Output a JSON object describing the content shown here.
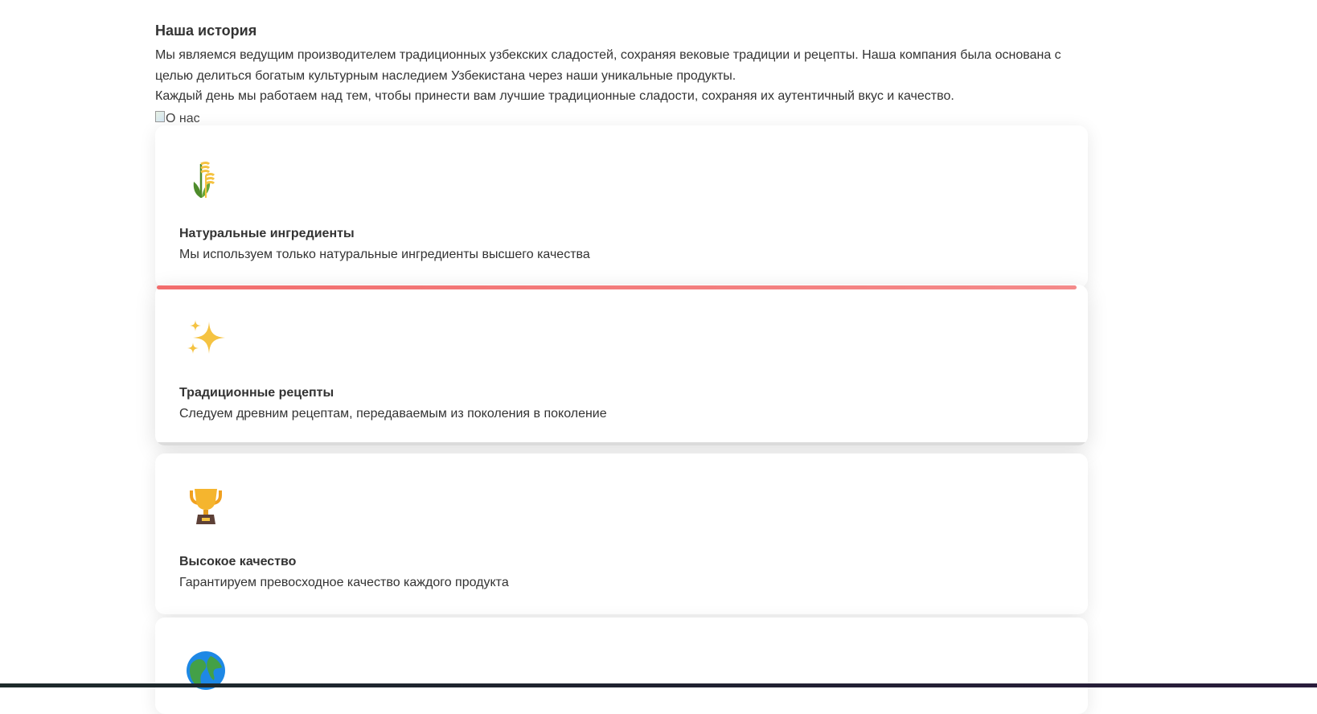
{
  "about": {
    "title": "Наша история",
    "paragraph1": "Мы являемся ведущим производителем традиционных узбекских сладостей, сохраняя вековые традиции и рецепты. Наша компания была основана с целью делиться богатым культурным наследием Узбекистана через наши уникальные продукты.",
    "paragraph2": "Каждый день мы работаем над тем, чтобы принести вам лучшие традиционные сладости, сохраняя их аутентичный вкус и качество.",
    "image_alt": "О нас"
  },
  "features": [
    {
      "icon": "wheat-icon",
      "title": "Натуральные ингредиенты",
      "description": "Мы используем только натуральные ингредиенты высшего качества"
    },
    {
      "icon": "sparkles-icon",
      "title": "Традиционные рецепты",
      "description": "Следуем древним рецептам, передаваемым из поколения в поколение"
    },
    {
      "icon": "trophy-icon",
      "title": "Высокое качество",
      "description": "Гарантируем превосходное качество каждого продукта"
    },
    {
      "icon": "globe-icon"
    }
  ],
  "colors": {
    "accent": "#f26d6d",
    "text": "#333333",
    "icon_gold": "#f5c342",
    "icon_green": "#4e8b2b"
  }
}
